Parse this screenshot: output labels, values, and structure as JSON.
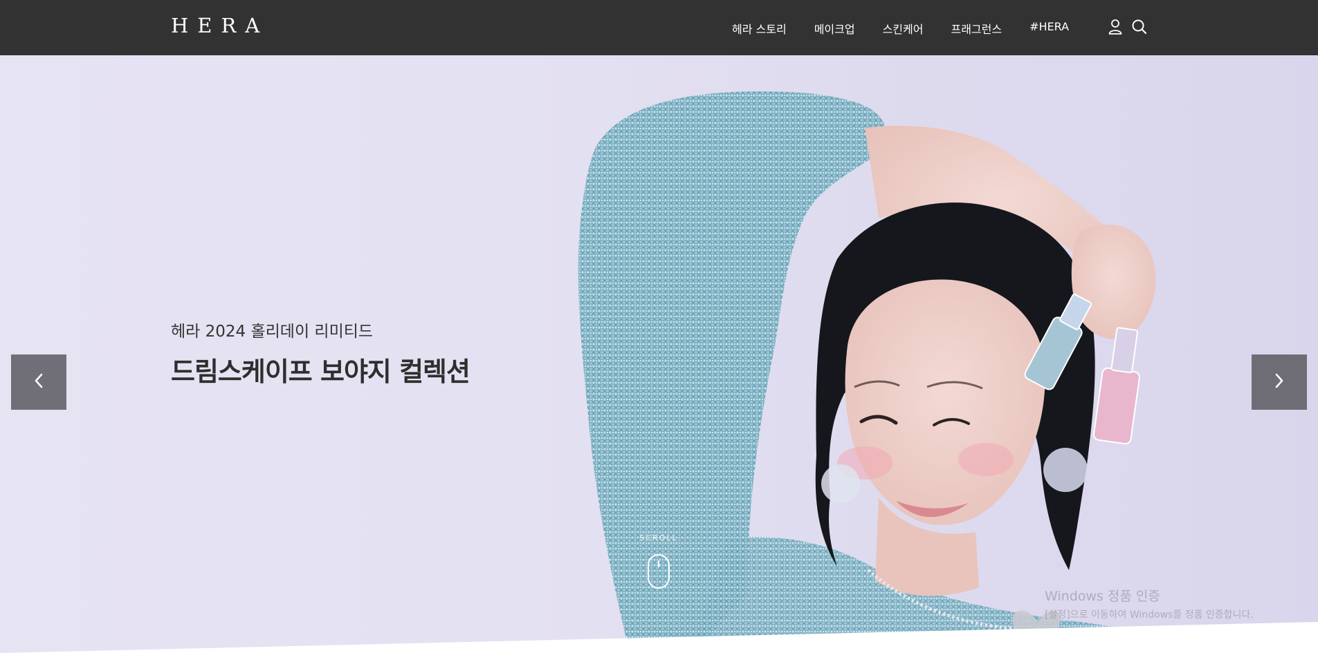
{
  "header": {
    "logo": "HERA",
    "nav": [
      "헤라 스토리",
      "메이크업",
      "스킨케어",
      "프래그런스",
      "#HERA"
    ],
    "icons": [
      "user-icon",
      "search-icon"
    ]
  },
  "hero": {
    "subtitle": "헤라 2024 홀리데이 리미티드",
    "title": "드림스케이프 보야지 컬렉션",
    "prev_icon": "chevron-left-icon",
    "next_icon": "chevron-right-icon",
    "scroll_label": "SCROLL",
    "scroll_icon": "mouse-icon"
  },
  "watermark": {
    "title": "Windows 정품 인증",
    "subtitle": "[설정]으로 이동하여 Windows를 정품 인증합니다."
  },
  "colors": {
    "header_bg": "#323232",
    "hero_bg": "#e4e1f2",
    "dress": "#7fb3c4"
  }
}
